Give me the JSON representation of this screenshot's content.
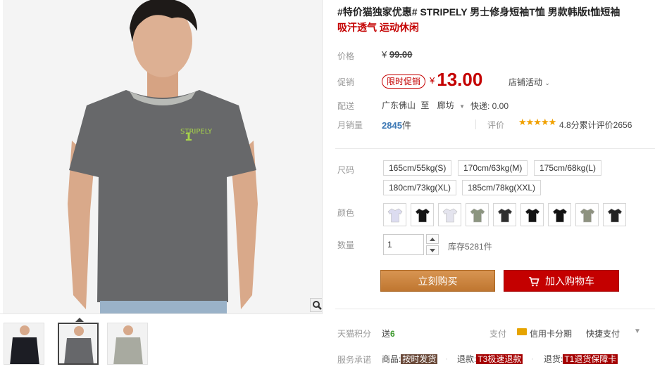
{
  "product": {
    "title": "#特价猫独家优惠# STRIPELY 男士修身短袖T恤 男款韩版t恤短袖",
    "subtitle": "吸汗透气 运动休闲",
    "shirt_print": "STRIPELY"
  },
  "price": {
    "label": "价格",
    "currency": "¥",
    "original": "99.00",
    "promo_label": "促销",
    "promo_badge": "限时促销",
    "current": "13.00",
    "shop_activity": "店铺活动"
  },
  "shipping": {
    "label": "配送",
    "from": "广东佛山",
    "to_word": "至",
    "dest": "廊坊",
    "fee": "快递: 0.00"
  },
  "sales": {
    "label": "月销量",
    "count": "2845",
    "unit": "件",
    "rating_label": "评价",
    "stars": "★★★★★",
    "rating_text": "4.8分累计评价2656"
  },
  "sizes": {
    "label": "尺码",
    "options": [
      "165cm/55kg(S)",
      "170cm/63kg(M)",
      "175cm/68kg(L)",
      "180cm/73kg(XL)",
      "185cm/78kg(XXL)"
    ]
  },
  "colors": {
    "label": "颜色",
    "swatches": [
      "#dcdcf0",
      "#151515",
      "#e4e4ee",
      "#8c9580",
      "#2e2e2e",
      "#141414",
      "#121212",
      "#8e9280",
      "#222222"
    ]
  },
  "quantity": {
    "label": "数量",
    "value": "1",
    "stock": "库存5281件"
  },
  "actions": {
    "buy_now": "立刻购买",
    "add_to_cart": "加入购物车"
  },
  "points": {
    "label": "天猫积分",
    "prefix": "送",
    "value": "6"
  },
  "payment": {
    "label": "支付",
    "option1": "信用卡分期",
    "option2": "快捷支付"
  },
  "services": {
    "label": "服务承诺",
    "item1_prefix": "商品:",
    "item1_tag": "按时发货",
    "item2_prefix": "退款:",
    "item2_tag": "T3极速退款",
    "item3_prefix": "退货:",
    "item3_tag": "T1退货保障卡"
  }
}
